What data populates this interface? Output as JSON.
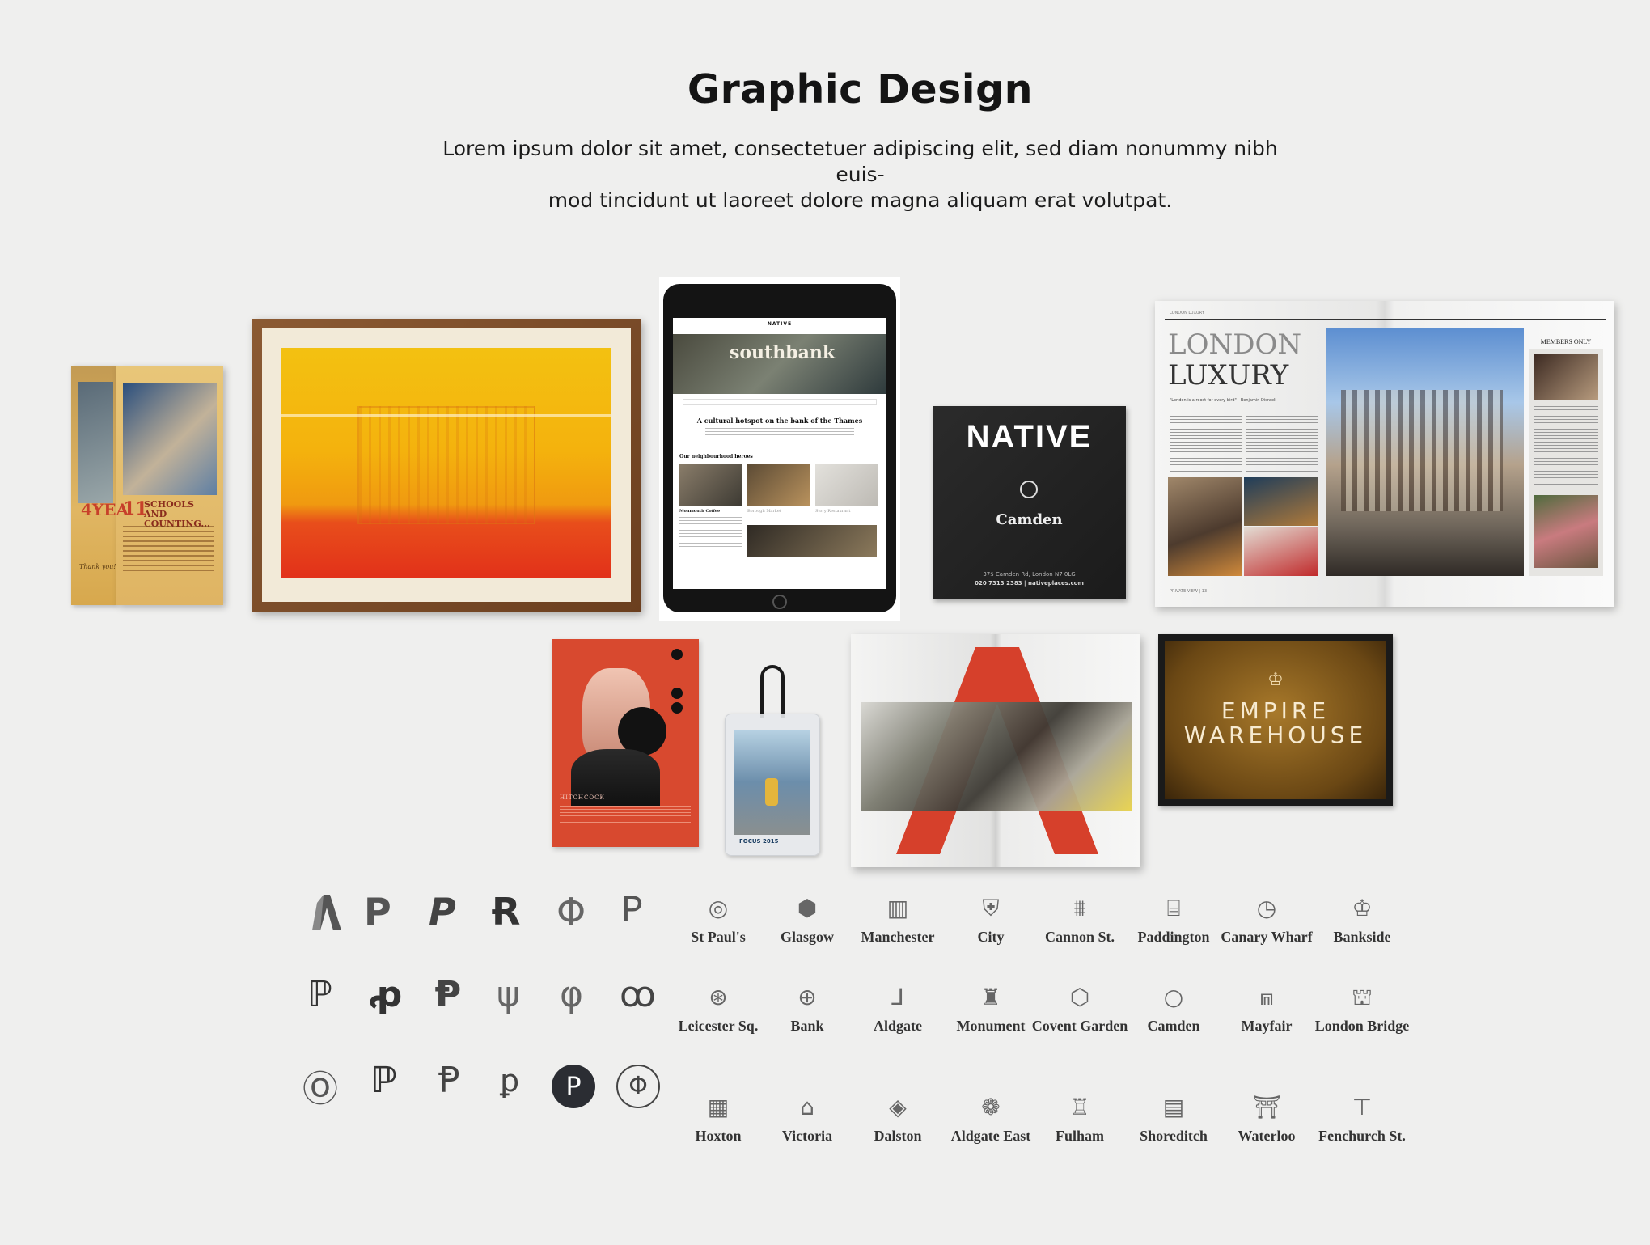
{
  "header": {
    "title": "Graphic Design",
    "intro_line1": "Lorem ipsum dolor sit amet, consectetuer adipiscing elit, sed diam nonummy nibh euis-",
    "intro_line2": "mod tincidunt ut laoreet dolore magna aliquam erat volutpat."
  },
  "brochure": {
    "big": "4YEA",
    "num": "11",
    "heading": "SCHOOLS AND COUNTING...",
    "sign": "Thank you!"
  },
  "tablet": {
    "brand": "NATIVE",
    "hero": "southbank",
    "headline": "A cultural hotspot on the bank of the Thames",
    "section": "Our neighbourhood heroes",
    "card1": "Monmouth Coffee",
    "card2": "Borough Market",
    "card3": "Story Restaurant"
  },
  "native_card": {
    "brand": "NATIVE",
    "place": "Camden",
    "address": "37$ Camden Rd, London N7 0LG",
    "contact": "020 7313 2383 | nativeplaces.com"
  },
  "magazine": {
    "kicker": "LONDON LUXURY",
    "title1": "LONDON",
    "title2": "LUXURY",
    "quote": "\"London is a roost for every bird\" - Benjamin Disraeli",
    "members": "MEMBERS ONLY",
    "footer": "PRIVATE VIEW | 13"
  },
  "poster": {
    "caption": "HITCHCOCK"
  },
  "lanyard": {
    "caption": "FOCUS 2015"
  },
  "empire": {
    "line1": "EMPIRE",
    "line2": "WAREHOUSE"
  },
  "logo_marks": [
    "monogram-a-icon",
    "monogram-p-icon",
    "monogram-p-icon",
    "monogram-rp-icon",
    "monogram-p-icon",
    "monogram-p-icon",
    "monogram-pp-icon",
    "monogram-pp-icon",
    "monogram-p-icon",
    "monogram-p-icon",
    "monogram-p-icon",
    "monogram-pp-icon",
    "monogram-p-icon",
    "monogram-pp-icon",
    "monogram-p-icon",
    "monogram-p-icon",
    "monogram-p-icon",
    "monogram-p-icon"
  ],
  "locations": [
    {
      "label": "St Paul's",
      "icon": "dome-icon"
    },
    {
      "label": "Glasgow",
      "icon": "thistle-icon"
    },
    {
      "label": "Manchester",
      "icon": "building-icon"
    },
    {
      "label": "City",
      "icon": "crest-icon"
    },
    {
      "label": "Cannon St.",
      "icon": "arches-icon"
    },
    {
      "label": "Paddington",
      "icon": "station-icon"
    },
    {
      "label": "Canary Wharf",
      "icon": "clock-icon"
    },
    {
      "label": "Bankside",
      "icon": "crown-icon"
    },
    {
      "label": "Leicester Sq.",
      "icon": "film-reel-icon"
    },
    {
      "label": "Bank",
      "icon": "coin-icon"
    },
    {
      "label": "Aldgate",
      "icon": "pump-icon"
    },
    {
      "label": "Monument",
      "icon": "column-icon"
    },
    {
      "label": "Covent Garden",
      "icon": "hexagon-icon"
    },
    {
      "label": "Camden",
      "icon": "ring-icon"
    },
    {
      "label": "Mayfair",
      "icon": "doorway-icon"
    },
    {
      "label": "London Bridge",
      "icon": "bridge-icon"
    },
    {
      "label": "Hoxton",
      "icon": "factory-icon"
    },
    {
      "label": "Victoria",
      "icon": "shard-icon"
    },
    {
      "label": "Dalston",
      "icon": "diamond-icon"
    },
    {
      "label": "Aldgate East",
      "icon": "flower-icon"
    },
    {
      "label": "Fulham",
      "icon": "castle-icon"
    },
    {
      "label": "Shoreditch",
      "icon": "stripes-icon"
    },
    {
      "label": "Waterloo",
      "icon": "temple-icon"
    },
    {
      "label": "Fenchurch St.",
      "icon": "canopy-icon"
    }
  ],
  "colors": {
    "background": "#efefee",
    "poster_red": "#d8492f",
    "empire_brown": "#6a4714",
    "native_dark": "#222222"
  }
}
